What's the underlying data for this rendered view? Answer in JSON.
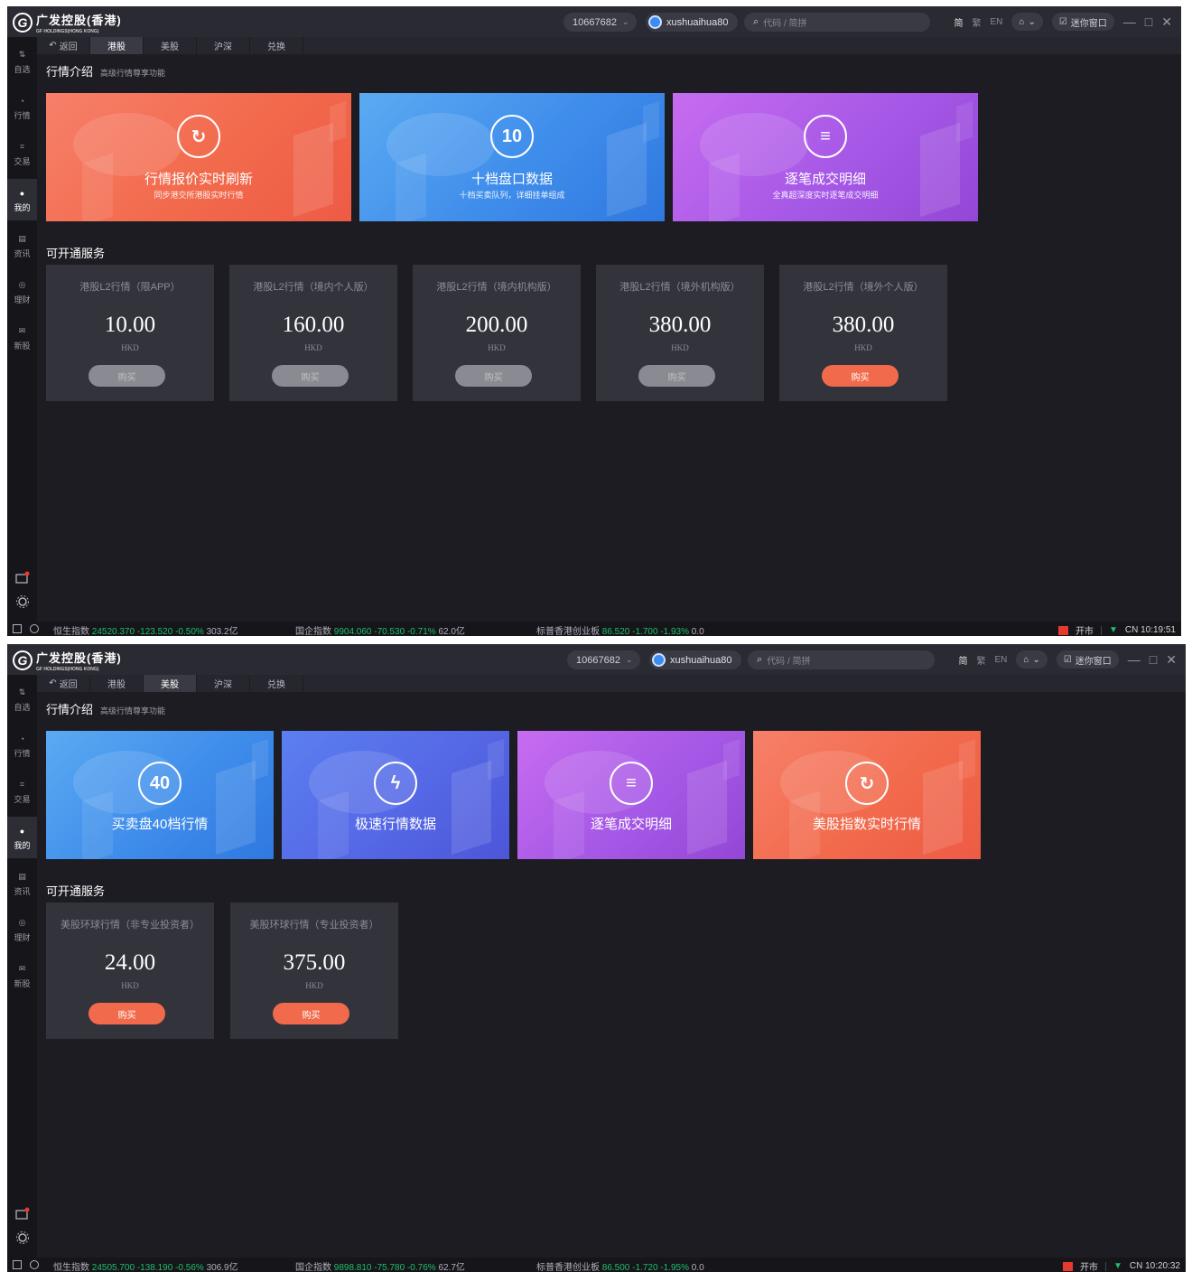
{
  "app": {
    "logo_cn": "广发控股(香港)",
    "logo_en": "GF HOLDINGS(HONG KONG)",
    "account_id": "10667682",
    "username": "xushuaihua80",
    "search_placeholder": "代码 / 简拼",
    "lang_simplified": "简",
    "lang_traditional": "繁",
    "lang_en": "EN",
    "mini_window": "迷你窗口"
  },
  "sidebar": [
    {
      "label": "自选",
      "icon": "watchlist-icon"
    },
    {
      "label": "行情",
      "icon": "market-icon"
    },
    {
      "label": "交易",
      "icon": "trade-icon"
    },
    {
      "label": "我的",
      "icon": "user-icon"
    },
    {
      "label": "资讯",
      "icon": "news-icon"
    },
    {
      "label": "理财",
      "icon": "wealth-icon"
    },
    {
      "label": "新股",
      "icon": "ipo-icon"
    }
  ],
  "tabs": [
    "返回",
    "港股",
    "美股",
    "沪深",
    "兑换"
  ],
  "section_intro_title": "行情介绍",
  "section_intro_sub": "高级行情尊享功能",
  "section_services_title": "可开通服务",
  "screen1": {
    "active_tab": "港股",
    "banners": [
      {
        "title": "行情报价实时刷新",
        "subtitle": "同步港交所港股实时行情",
        "icon": "refresh-icon",
        "icon_text": "↻",
        "color": "orange"
      },
      {
        "title": "十档盘口数据",
        "subtitle": "十档买卖队列，详细挂单组成",
        "icon": "ten-levels-icon",
        "icon_text": "10",
        "color": "blue"
      },
      {
        "title": "逐笔成交明细",
        "subtitle": "全真超深度实时逐笔成交明细",
        "icon": "list-icon",
        "icon_text": "≡",
        "color": "purple"
      }
    ],
    "services": [
      {
        "name": "港股L2行情（限APP）",
        "price": "10.00",
        "currency": "HKD",
        "button": "购买",
        "enabled": false
      },
      {
        "name": "港股L2行情（境内个人版）",
        "price": "160.00",
        "currency": "HKD",
        "button": "购买",
        "enabled": false
      },
      {
        "name": "港股L2行情（境内机构版）",
        "price": "200.00",
        "currency": "HKD",
        "button": "购买",
        "enabled": false
      },
      {
        "name": "港股L2行情（境外机构版）",
        "price": "380.00",
        "currency": "HKD",
        "button": "购买",
        "enabled": false
      },
      {
        "name": "港股L2行情（境外个人版）",
        "price": "380.00",
        "currency": "HKD",
        "button": "购买",
        "enabled": true
      }
    ],
    "status": {
      "indices": [
        {
          "name": "恒生指数",
          "value": "24520.370 -123.520 -0.50%",
          "volume": "303.2亿"
        },
        {
          "name": "国企指数",
          "value": "9904.060 -70.530 -0.71%",
          "volume": "62.0亿"
        },
        {
          "name": "标普香港创业板",
          "value": "86.520 -1.700 -1.93%",
          "volume": "0.0"
        }
      ],
      "market_state": "开市",
      "clock": "CN 10:19:51"
    }
  },
  "screen2": {
    "active_tab": "美股",
    "banners": [
      {
        "title": "买卖盘40档行情",
        "subtitle": "",
        "icon": "forty-levels-icon",
        "icon_text": "40",
        "color": "blue"
      },
      {
        "title": "极速行情数据",
        "subtitle": "",
        "icon": "lightning-icon",
        "icon_text": "ϟ",
        "color": "indigo"
      },
      {
        "title": "逐笔成交明细",
        "subtitle": "",
        "icon": "list-icon",
        "icon_text": "≡",
        "color": "purple"
      },
      {
        "title": "美股指数实时行情",
        "subtitle": "",
        "icon": "refresh-icon",
        "icon_text": "↻",
        "color": "orange"
      }
    ],
    "services": [
      {
        "name": "美股环球行情（非专业投资者）",
        "price": "24.00",
        "currency": "HKD",
        "button": "购买",
        "enabled": true
      },
      {
        "name": "美股环球行情（专业投资者）",
        "price": "375.00",
        "currency": "HKD",
        "button": "购买",
        "enabled": true
      }
    ],
    "status": {
      "indices": [
        {
          "name": "恒生指数",
          "value": "24505.700 -138.190 -0.56%",
          "volume": "306.9亿"
        },
        {
          "name": "国企指数",
          "value": "9898.810 -75.780 -0.76%",
          "volume": "62.7亿"
        },
        {
          "name": "标普香港创业板",
          "value": "86.500 -1.720 -1.95%",
          "volume": "0.0"
        }
      ],
      "market_state": "开市",
      "clock": "CN 10:20:32"
    }
  }
}
